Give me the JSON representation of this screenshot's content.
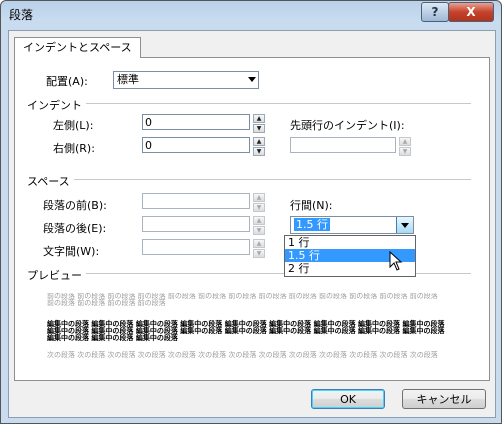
{
  "window": {
    "title": "段落",
    "help_label": "?",
    "close_label": "X"
  },
  "tab": {
    "label": "インデントとスペース"
  },
  "alignment": {
    "label": "配置(A):",
    "value": "標準"
  },
  "indent": {
    "section": "インデント",
    "left_label": "左側(L):",
    "left_value": "0",
    "right_label": "右側(R):",
    "right_value": "0",
    "first_line_label": "先頭行のインデント(I):",
    "first_line_value": ""
  },
  "spacing": {
    "section": "スペース",
    "before_label": "段落の前(B):",
    "before_value": "",
    "after_label": "段落の後(E):",
    "after_value": "",
    "char_label": "文字間(W):",
    "char_value": "",
    "line_label": "行間(N):",
    "line_value": "1.5 行",
    "line_options": [
      "1 行",
      "1.5 行",
      "2 行"
    ]
  },
  "preview": {
    "section": "プレビュー",
    "prev_lines": [
      "前の段落 前の段落 前の段落 前の段落 前の段落 前の段落 前の段落 前の段落 前の段落 前の段落 前の段落 前の段落 前の段落",
      "前の段落 前の段落 前の段落 前の段落"
    ],
    "cur_lines": [
      "編集中の段落 編集中の段落 編集中の段落 編集中の段落 編集中の段落 編集中の段落 編集中の段落 編集中の段落 編集中の段落",
      "編集中の段落 編集中の段落 編集中の段落 編集中の段落 編集中の段落 編集中の段落 編集中の段落 編集中の段落 編集中の段落",
      "編集中の段落 編集中の段落 編集中の段落"
    ],
    "next_lines": [
      "次の段落 次の段落 次の段落 次の段落 次の段落 次の段落 次の段落 次の段落 次の段落 次の段落 次の段落 次の段落 次の段落"
    ]
  },
  "buttons": {
    "ok": "OK",
    "cancel": "キャンセル"
  }
}
